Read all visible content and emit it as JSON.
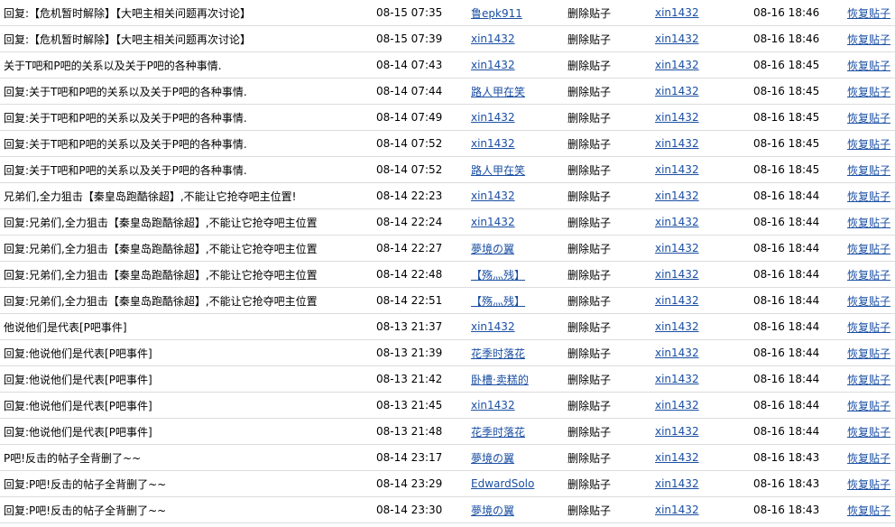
{
  "colors": {
    "link": "#1a4fa3",
    "row_divider": "#dcdcdc",
    "text": "#000000"
  },
  "rows": [
    {
      "title": "回复:【危机暂时解除】【大吧主相关问题再次讨论】",
      "post_time": "08-15 07:35",
      "author": "鲁epk911",
      "action": "删除贴子",
      "operator": "xin1432",
      "op_time": "08-16 18:46",
      "restore": "恢复贴子"
    },
    {
      "title": "回复:【危机暂时解除】【大吧主相关问题再次讨论】",
      "post_time": "08-15 07:39",
      "author": "xin1432",
      "action": "删除贴子",
      "operator": "xin1432",
      "op_time": "08-16 18:46",
      "restore": "恢复贴子"
    },
    {
      "title": "关于T吧和P吧的关系以及关于P吧的各种事情.",
      "post_time": "08-14 07:43",
      "author": "xin1432",
      "action": "删除贴子",
      "operator": "xin1432",
      "op_time": "08-16 18:45",
      "restore": "恢复贴子"
    },
    {
      "title": "回复:关于T吧和P吧的关系以及关于P吧的各种事情.",
      "post_time": "08-14 07:44",
      "author": "路人甲在笑",
      "action": "删除贴子",
      "operator": "xin1432",
      "op_time": "08-16 18:45",
      "restore": "恢复贴子"
    },
    {
      "title": "回复:关于T吧和P吧的关系以及关于P吧的各种事情.",
      "post_time": "08-14 07:49",
      "author": "xin1432",
      "action": "删除贴子",
      "operator": "xin1432",
      "op_time": "08-16 18:45",
      "restore": "恢复贴子"
    },
    {
      "title": "回复:关于T吧和P吧的关系以及关于P吧的各种事情.",
      "post_time": "08-14 07:52",
      "author": "xin1432",
      "action": "删除贴子",
      "operator": "xin1432",
      "op_time": "08-16 18:45",
      "restore": "恢复贴子"
    },
    {
      "title": "回复:关于T吧和P吧的关系以及关于P吧的各种事情.",
      "post_time": "08-14 07:52",
      "author": "路人甲在笑",
      "action": "删除贴子",
      "operator": "xin1432",
      "op_time": "08-16 18:45",
      "restore": "恢复贴子"
    },
    {
      "title": "兄弟们,全力狙击【秦皇岛跑酷徐超】,不能让它抢夺吧主位置!",
      "post_time": "08-14 22:23",
      "author": "xin1432",
      "action": "删除贴子",
      "operator": "xin1432",
      "op_time": "08-16 18:44",
      "restore": "恢复贴子"
    },
    {
      "title": "回复:兄弟们,全力狙击【秦皇岛跑酷徐超】,不能让它抢夺吧主位置",
      "post_time": "08-14 22:24",
      "author": "xin1432",
      "action": "删除贴子",
      "operator": "xin1432",
      "op_time": "08-16 18:44",
      "restore": "恢复贴子"
    },
    {
      "title": "回复:兄弟们,全力狙击【秦皇岛跑酷徐超】,不能让它抢夺吧主位置",
      "post_time": "08-14 22:27",
      "author": "夢境の翼",
      "action": "删除贴子",
      "operator": "xin1432",
      "op_time": "08-16 18:44",
      "restore": "恢复贴子"
    },
    {
      "title": "回复:兄弟们,全力狙击【秦皇岛跑酷徐超】,不能让它抢夺吧主位置",
      "post_time": "08-14 22:48",
      "author": "【殇灬残】",
      "action": "删除贴子",
      "operator": "xin1432",
      "op_time": "08-16 18:44",
      "restore": "恢复贴子"
    },
    {
      "title": "回复:兄弟们,全力狙击【秦皇岛跑酷徐超】,不能让它抢夺吧主位置",
      "post_time": "08-14 22:51",
      "author": "【殇灬残】",
      "action": "删除贴子",
      "operator": "xin1432",
      "op_time": "08-16 18:44",
      "restore": "恢复贴子"
    },
    {
      "title": "他说他们是代表[P吧事件]",
      "post_time": "08-13 21:37",
      "author": "xin1432",
      "action": "删除贴子",
      "operator": "xin1432",
      "op_time": "08-16 18:44",
      "restore": "恢复贴子"
    },
    {
      "title": "回复:他说他们是代表[P吧事件]",
      "post_time": "08-13 21:39",
      "author": "花季时落花",
      "action": "删除贴子",
      "operator": "xin1432",
      "op_time": "08-16 18:44",
      "restore": "恢复贴子"
    },
    {
      "title": "回复:他说他们是代表[P吧事件]",
      "post_time": "08-13 21:42",
      "author": "卧槽·卖糕的",
      "action": "删除贴子",
      "operator": "xin1432",
      "op_time": "08-16 18:44",
      "restore": "恢复贴子"
    },
    {
      "title": "回复:他说他们是代表[P吧事件]",
      "post_time": "08-13 21:45",
      "author": "xin1432",
      "action": "删除贴子",
      "operator": "xin1432",
      "op_time": "08-16 18:44",
      "restore": "恢复贴子"
    },
    {
      "title": "回复:他说他们是代表[P吧事件]",
      "post_time": "08-13 21:48",
      "author": "花季时落花",
      "action": "删除贴子",
      "operator": "xin1432",
      "op_time": "08-16 18:44",
      "restore": "恢复贴子"
    },
    {
      "title": "P吧!反击的帖子全背删了~~",
      "post_time": "08-14 23:17",
      "author": "夢境の翼",
      "action": "删除贴子",
      "operator": "xin1432",
      "op_time": "08-16 18:43",
      "restore": "恢复贴子"
    },
    {
      "title": "回复:P吧!反击的帖子全背删了~~",
      "post_time": "08-14 23:29",
      "author": "EdwardSolo",
      "action": "删除贴子",
      "operator": "xin1432",
      "op_time": "08-16 18:43",
      "restore": "恢复贴子"
    },
    {
      "title": "回复:P吧!反击的帖子全背删了~~",
      "post_time": "08-14 23:30",
      "author": "夢境の翼",
      "action": "删除贴子",
      "operator": "xin1432",
      "op_time": "08-16 18:43",
      "restore": "恢复贴子"
    }
  ]
}
